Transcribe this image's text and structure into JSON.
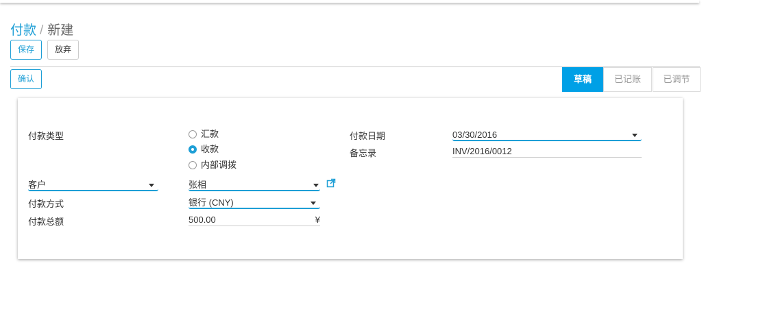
{
  "breadcrumb": {
    "parent": "付款",
    "separator": "/",
    "current": "新建"
  },
  "toolbar": {
    "save_label": "保存",
    "discard_label": "放弃"
  },
  "header": {
    "confirm_label": "确认"
  },
  "statusbar": {
    "items": [
      {
        "label": "草稿",
        "active": true
      },
      {
        "label": "已记账",
        "active": false
      },
      {
        "label": "已调节",
        "active": false
      }
    ]
  },
  "form": {
    "payment_type": {
      "label": "付款类型",
      "options": [
        {
          "label": "汇款",
          "checked": false
        },
        {
          "label": "收款",
          "checked": true
        },
        {
          "label": "内部调拨",
          "checked": false
        }
      ]
    },
    "partner_type": {
      "value": "客户"
    },
    "partner": {
      "value": "张相"
    },
    "journal": {
      "label": "付款方式",
      "value": "银行 (CNY)"
    },
    "amount": {
      "label": "付款总额",
      "value": "500.00",
      "currency": "¥"
    },
    "payment_date": {
      "label": "付款日期",
      "value": "03/30/2016"
    },
    "memo": {
      "label": "备忘录",
      "value": "INV/2016/0012"
    }
  },
  "colors": {
    "accent": "#1e9fd6",
    "status_active": "#00a0e6"
  }
}
